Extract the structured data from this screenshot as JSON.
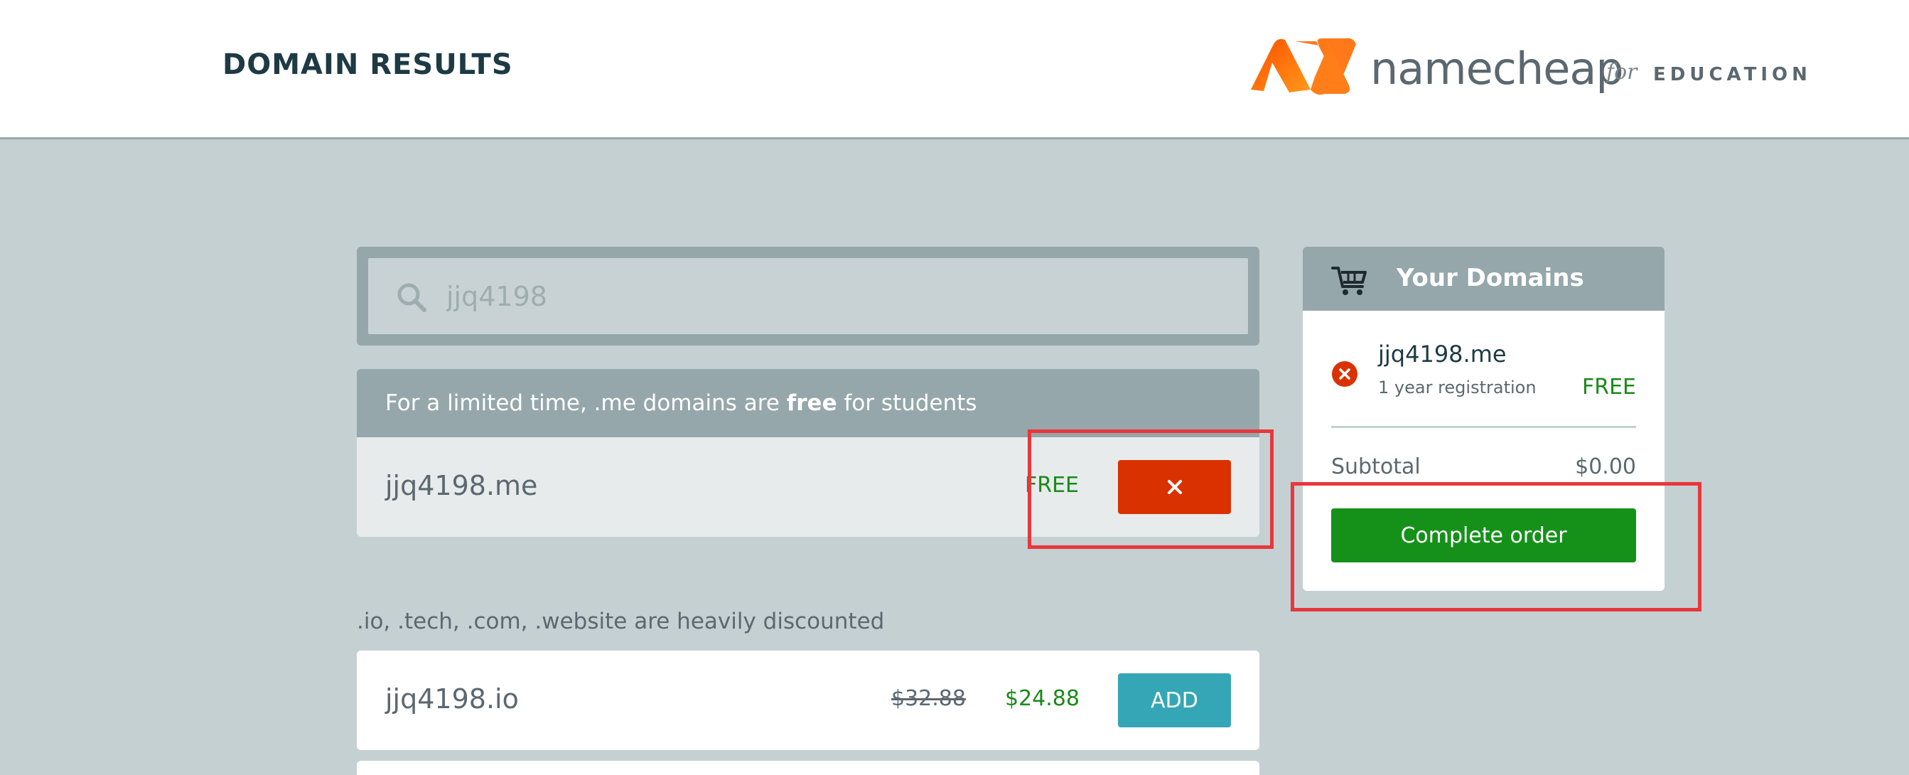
{
  "header": {
    "title": "DOMAIN RESULTS",
    "logo": {
      "name": "namecheap",
      "for": "for",
      "edu": "EDUCATION",
      "brand_color_light": "#ff8a00",
      "brand_color_dark": "#ff4c00"
    }
  },
  "search": {
    "value": "jjq4198",
    "icon": "search-icon"
  },
  "promo": {
    "text_before": "For a limited time, .me domains are ",
    "text_bold": "free",
    "text_after": " for students",
    "result": {
      "domain": "jjq4198.me",
      "price": "FREE",
      "button_icon": "close-icon",
      "button_color": "#d93200"
    }
  },
  "discount_section": {
    "heading": ".io, .tech, .com, .website are heavily discounted",
    "results": [
      {
        "domain": "jjq4198.io",
        "old_price": "$32.88",
        "new_price": "$24.88",
        "button_label": "ADD",
        "button_color": "#35a6b5"
      }
    ]
  },
  "cart": {
    "title": "Your Domains",
    "icon": "cart-icon",
    "items": [
      {
        "domain": "jjq4198.me",
        "term": "1 year registration",
        "price": "FREE",
        "remove_icon": "remove-circle-icon"
      }
    ],
    "subtotal_label": "Subtotal",
    "subtotal_value": "$0.00",
    "complete_label": "Complete order",
    "complete_color": "#15911a"
  },
  "colors": {
    "background": "#c5d0d3",
    "panel_header": "#95a7aa",
    "price_green": "#1a8a1a",
    "highlight_red": "#e8373c"
  }
}
